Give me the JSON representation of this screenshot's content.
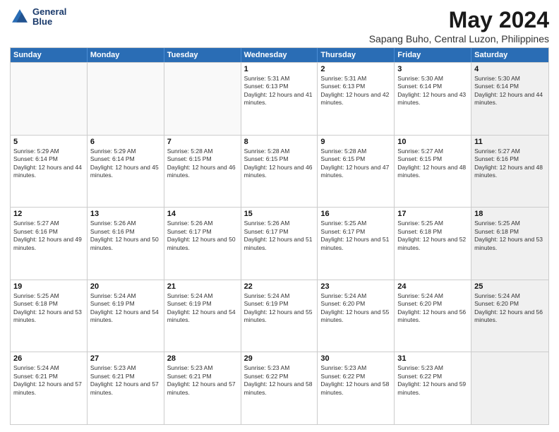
{
  "header": {
    "logo_line1": "General",
    "logo_line2": "Blue",
    "month_year": "May 2024",
    "location": "Sapang Buho, Central Luzon, Philippines"
  },
  "days_of_week": [
    "Sunday",
    "Monday",
    "Tuesday",
    "Wednesday",
    "Thursday",
    "Friday",
    "Saturday"
  ],
  "weeks": [
    [
      {
        "day": "",
        "empty": true
      },
      {
        "day": "",
        "empty": true
      },
      {
        "day": "",
        "empty": true
      },
      {
        "day": "1",
        "sunrise": "5:31 AM",
        "sunset": "6:13 PM",
        "daylight": "12 hours and 41 minutes."
      },
      {
        "day": "2",
        "sunrise": "5:31 AM",
        "sunset": "6:13 PM",
        "daylight": "12 hours and 42 minutes."
      },
      {
        "day": "3",
        "sunrise": "5:30 AM",
        "sunset": "6:14 PM",
        "daylight": "12 hours and 43 minutes."
      },
      {
        "day": "4",
        "sunrise": "5:30 AM",
        "sunset": "6:14 PM",
        "daylight": "12 hours and 44 minutes.",
        "shaded": true
      }
    ],
    [
      {
        "day": "5",
        "sunrise": "5:29 AM",
        "sunset": "6:14 PM",
        "daylight": "12 hours and 44 minutes."
      },
      {
        "day": "6",
        "sunrise": "5:29 AM",
        "sunset": "6:14 PM",
        "daylight": "12 hours and 45 minutes."
      },
      {
        "day": "7",
        "sunrise": "5:28 AM",
        "sunset": "6:15 PM",
        "daylight": "12 hours and 46 minutes."
      },
      {
        "day": "8",
        "sunrise": "5:28 AM",
        "sunset": "6:15 PM",
        "daylight": "12 hours and 46 minutes."
      },
      {
        "day": "9",
        "sunrise": "5:28 AM",
        "sunset": "6:15 PM",
        "daylight": "12 hours and 47 minutes."
      },
      {
        "day": "10",
        "sunrise": "5:27 AM",
        "sunset": "6:15 PM",
        "daylight": "12 hours and 48 minutes."
      },
      {
        "day": "11",
        "sunrise": "5:27 AM",
        "sunset": "6:16 PM",
        "daylight": "12 hours and 48 minutes.",
        "shaded": true
      }
    ],
    [
      {
        "day": "12",
        "sunrise": "5:27 AM",
        "sunset": "6:16 PM",
        "daylight": "12 hours and 49 minutes."
      },
      {
        "day": "13",
        "sunrise": "5:26 AM",
        "sunset": "6:16 PM",
        "daylight": "12 hours and 50 minutes."
      },
      {
        "day": "14",
        "sunrise": "5:26 AM",
        "sunset": "6:17 PM",
        "daylight": "12 hours and 50 minutes."
      },
      {
        "day": "15",
        "sunrise": "5:26 AM",
        "sunset": "6:17 PM",
        "daylight": "12 hours and 51 minutes."
      },
      {
        "day": "16",
        "sunrise": "5:25 AM",
        "sunset": "6:17 PM",
        "daylight": "12 hours and 51 minutes."
      },
      {
        "day": "17",
        "sunrise": "5:25 AM",
        "sunset": "6:18 PM",
        "daylight": "12 hours and 52 minutes."
      },
      {
        "day": "18",
        "sunrise": "5:25 AM",
        "sunset": "6:18 PM",
        "daylight": "12 hours and 53 minutes.",
        "shaded": true
      }
    ],
    [
      {
        "day": "19",
        "sunrise": "5:25 AM",
        "sunset": "6:18 PM",
        "daylight": "12 hours and 53 minutes."
      },
      {
        "day": "20",
        "sunrise": "5:24 AM",
        "sunset": "6:19 PM",
        "daylight": "12 hours and 54 minutes."
      },
      {
        "day": "21",
        "sunrise": "5:24 AM",
        "sunset": "6:19 PM",
        "daylight": "12 hours and 54 minutes."
      },
      {
        "day": "22",
        "sunrise": "5:24 AM",
        "sunset": "6:19 PM",
        "daylight": "12 hours and 55 minutes."
      },
      {
        "day": "23",
        "sunrise": "5:24 AM",
        "sunset": "6:20 PM",
        "daylight": "12 hours and 55 minutes."
      },
      {
        "day": "24",
        "sunrise": "5:24 AM",
        "sunset": "6:20 PM",
        "daylight": "12 hours and 56 minutes."
      },
      {
        "day": "25",
        "sunrise": "5:24 AM",
        "sunset": "6:20 PM",
        "daylight": "12 hours and 56 minutes.",
        "shaded": true
      }
    ],
    [
      {
        "day": "26",
        "sunrise": "5:24 AM",
        "sunset": "6:21 PM",
        "daylight": "12 hours and 57 minutes."
      },
      {
        "day": "27",
        "sunrise": "5:23 AM",
        "sunset": "6:21 PM",
        "daylight": "12 hours and 57 minutes."
      },
      {
        "day": "28",
        "sunrise": "5:23 AM",
        "sunset": "6:21 PM",
        "daylight": "12 hours and 57 minutes."
      },
      {
        "day": "29",
        "sunrise": "5:23 AM",
        "sunset": "6:22 PM",
        "daylight": "12 hours and 58 minutes."
      },
      {
        "day": "30",
        "sunrise": "5:23 AM",
        "sunset": "6:22 PM",
        "daylight": "12 hours and 58 minutes."
      },
      {
        "day": "31",
        "sunrise": "5:23 AM",
        "sunset": "6:22 PM",
        "daylight": "12 hours and 59 minutes."
      },
      {
        "day": "",
        "empty": true,
        "shaded": true
      }
    ]
  ]
}
